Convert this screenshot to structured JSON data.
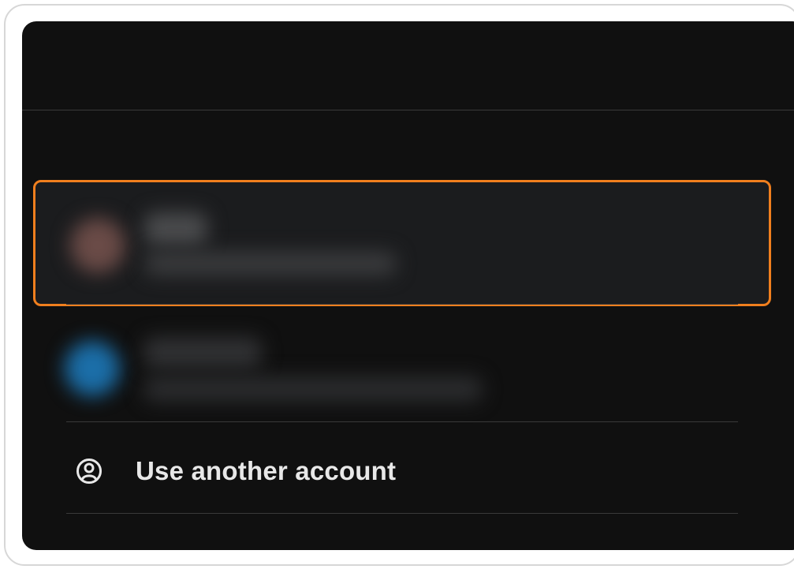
{
  "account_chooser": {
    "use_another_account_label": "Use another account",
    "icons": {
      "use_another_account": "account-circle-icon"
    },
    "colors": {
      "selection_border": "#f07f1e",
      "panel_background": "#101010",
      "text": "#e8e8e8"
    }
  }
}
